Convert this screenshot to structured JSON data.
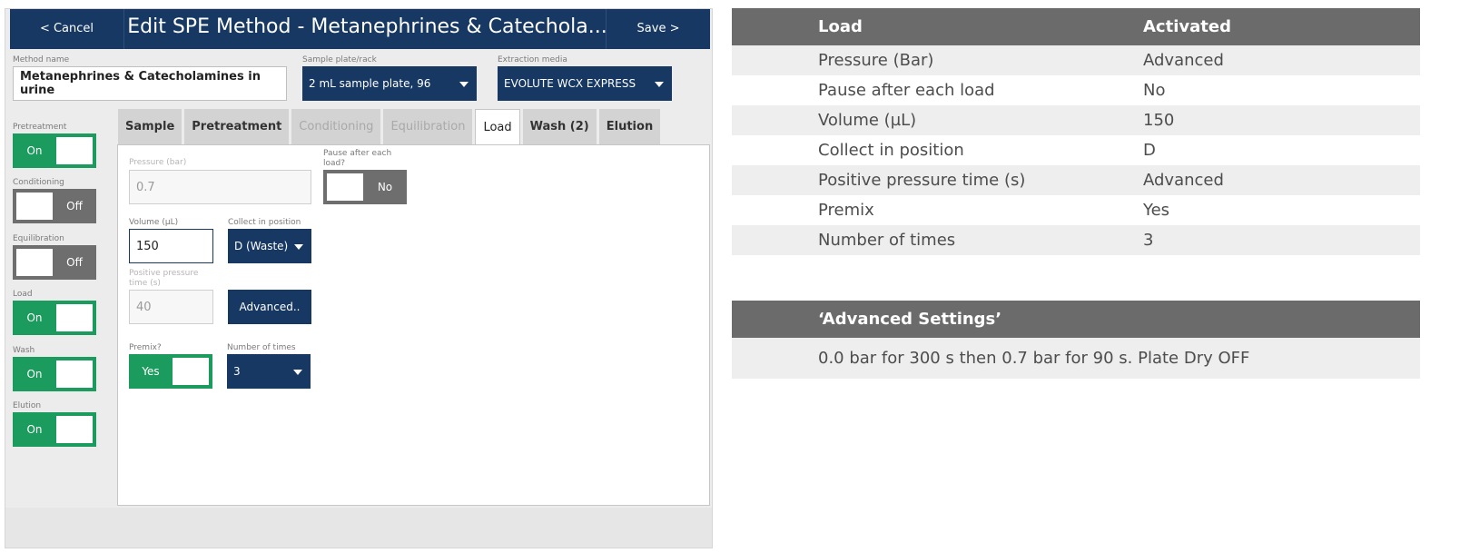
{
  "app": {
    "cancel_label": "< Cancel",
    "title": "Edit SPE Method - Metanephrines & Catechola...",
    "save_label": "Save >"
  },
  "method": {
    "name_label": "Method name",
    "name_value": "Metanephrines & Catecholamines in urine",
    "plate_label": "Sample plate/rack",
    "plate_value": "2 mL sample plate, 96",
    "media_label": "Extraction media",
    "media_value": "EVOLUTE WCX EXPRESS"
  },
  "steps": [
    {
      "label": "Pretreatment",
      "state": "On"
    },
    {
      "label": "Conditioning",
      "state": "Off"
    },
    {
      "label": "Equilibration",
      "state": "Off"
    },
    {
      "label": "Load",
      "state": "On"
    },
    {
      "label": "Wash",
      "state": "On"
    },
    {
      "label": "Elution",
      "state": "On"
    }
  ],
  "tabs": [
    {
      "label": "Sample",
      "state": "enabled"
    },
    {
      "label": "Pretreatment",
      "state": "enabled"
    },
    {
      "label": "Conditioning",
      "state": "disabled"
    },
    {
      "label": "Equilibration",
      "state": "disabled"
    },
    {
      "label": "Load",
      "state": "active"
    },
    {
      "label": "Wash (2)",
      "state": "enabled"
    },
    {
      "label": "Elution",
      "state": "enabled"
    }
  ],
  "load": {
    "pressure_label": "Pressure (bar)",
    "pressure_value": "0.7",
    "pause_label_1": "Pause after each",
    "pause_label_2": "load?",
    "pause_value": "No",
    "volume_label": "Volume (µL)",
    "volume_value": "150",
    "collect_label": "Collect in position",
    "collect_value": "D (Waste)",
    "ppt_label_1": "Positive pressure",
    "ppt_label_2": "time (s)",
    "ppt_value": "40",
    "advanced_label": "Advanced..",
    "premix_label": "Premix?",
    "premix_value": "Yes",
    "times_label": "Number of times",
    "times_value": "3"
  },
  "table1": {
    "header": [
      "Load",
      "Activated"
    ],
    "rows": [
      [
        "Pressure (Bar)",
        "Advanced"
      ],
      [
        "Pause after each load",
        "No"
      ],
      [
        "Volume (µL)",
        "150"
      ],
      [
        "Collect in position",
        "D"
      ],
      [
        "Positive pressure time (s)",
        "Advanced"
      ],
      [
        "Premix",
        "Yes"
      ],
      [
        "Number of times",
        "3"
      ]
    ]
  },
  "table2": {
    "header": "‘Advanced Settings’",
    "row": "0.0 bar for 300 s then 0.7 bar for 90 s. Plate Dry OFF"
  },
  "colors": {
    "navy": "#163863",
    "green": "#1b9b5d",
    "off_gray": "#6e6e6e",
    "table_header": "#6b6b6b"
  }
}
